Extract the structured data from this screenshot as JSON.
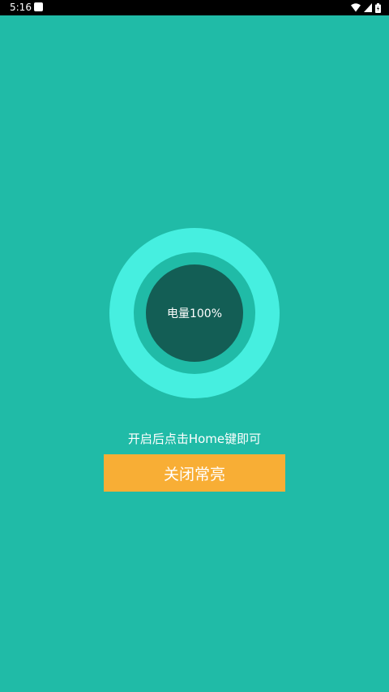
{
  "status_bar": {
    "time": "5:16",
    "icons": [
      "app-notification-icon",
      "wifi-icon",
      "cell-signal-icon",
      "battery-icon"
    ]
  },
  "battery_display": {
    "label": "电量100%",
    "level_percent": 100
  },
  "hint": {
    "text": "开启后点击Home键即可"
  },
  "action_button": {
    "label": "关闭常亮"
  },
  "colors": {
    "background": "#20BBA7",
    "ring_outer": "#46EFE0",
    "ring_inner": "#135E55",
    "button": "#F8AE35"
  }
}
